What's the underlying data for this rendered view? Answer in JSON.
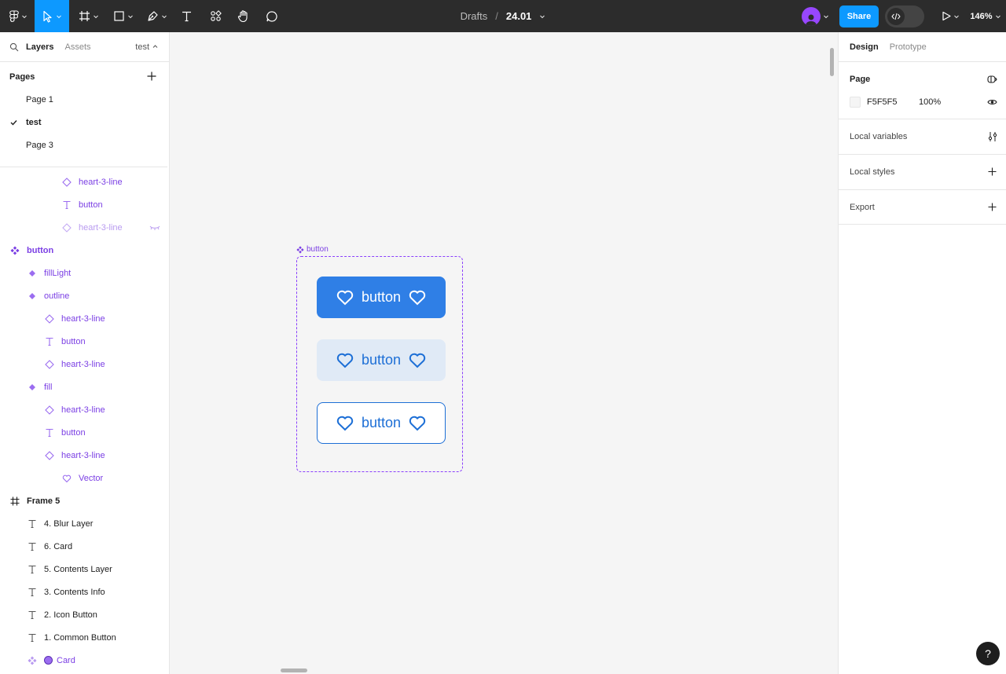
{
  "toolbar": {
    "breadcrumb_project": "Drafts",
    "breadcrumb_sep": "/",
    "file_name": "24.01",
    "share_label": "Share",
    "zoom": "146%",
    "accent": "#0d99ff"
  },
  "left_panel": {
    "tab_layers": "Layers",
    "tab_assets": "Assets",
    "current_page_switch": "test",
    "pages_heading": "Pages",
    "pages": [
      {
        "label": "Page 1"
      },
      {
        "label": "test"
      },
      {
        "label": "Page 3"
      }
    ],
    "layers": [
      {
        "label": "heart-3-line",
        "icon": "instance-icon"
      },
      {
        "label": "button",
        "icon": "text-icon"
      },
      {
        "label": "heart-3-line",
        "icon": "instance-icon"
      },
      {
        "label": "button",
        "icon": "component-set-icon"
      },
      {
        "label": "fillLight",
        "icon": "component-icon"
      },
      {
        "label": "outline",
        "icon": "component-icon"
      },
      {
        "label": "heart-3-line",
        "icon": "instance-icon"
      },
      {
        "label": "button",
        "icon": "text-icon"
      },
      {
        "label": "heart-3-line",
        "icon": "instance-icon"
      },
      {
        "label": "fill",
        "icon": "component-icon"
      },
      {
        "label": "heart-3-line",
        "icon": "instance-icon"
      },
      {
        "label": "button",
        "icon": "text-icon"
      },
      {
        "label": "heart-3-line",
        "icon": "instance-icon"
      },
      {
        "label": "Vector",
        "icon": "heart-icon"
      },
      {
        "label": "Frame 5",
        "icon": "frame-icon"
      },
      {
        "label": "4. Blur Layer",
        "icon": "text-icon"
      },
      {
        "label": "6. Card",
        "icon": "text-icon"
      },
      {
        "label": "5. Contents Layer",
        "icon": "text-icon"
      },
      {
        "label": "3. Contents Info",
        "icon": "text-icon"
      },
      {
        "label": "2. Icon Button",
        "icon": "text-icon"
      },
      {
        "label": "1. Common Button",
        "icon": "text-icon"
      },
      {
        "label": "Card",
        "icon": "component-set-icon"
      }
    ]
  },
  "canvas": {
    "component_label": "button",
    "buttons": [
      {
        "label": "button",
        "variant": "fill",
        "bg": "#2f7fe6",
        "fg": "#ffffff"
      },
      {
        "label": "button",
        "variant": "fillLight",
        "bg": "#e0eaf6",
        "fg": "#1d6fd6"
      },
      {
        "label": "button",
        "variant": "outline",
        "bg": "#ffffff",
        "fg": "#1d6fd6"
      }
    ]
  },
  "right_panel": {
    "tab_design": "Design",
    "tab_prototype": "Prototype",
    "page_heading": "Page",
    "page_color_hex": "F5F5F5",
    "page_color_opacity": "100%",
    "local_variables": "Local variables",
    "local_styles": "Local styles",
    "export": "Export"
  },
  "help_label": "?"
}
